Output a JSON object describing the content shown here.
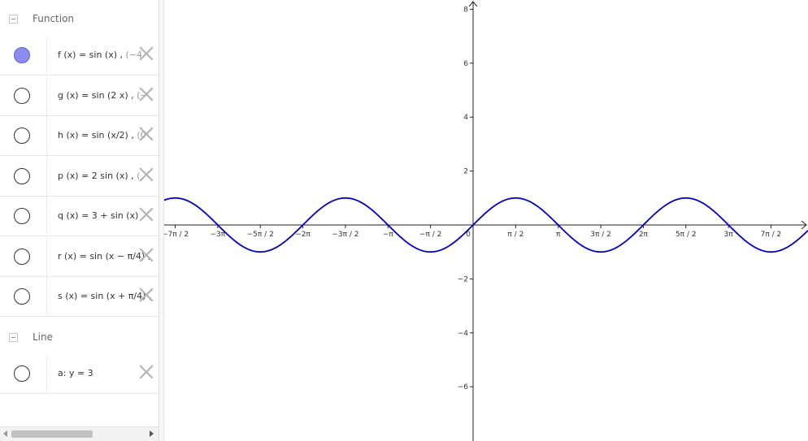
{
  "algebra": {
    "groups": [
      {
        "label": "Function",
        "items": [
          {
            "prefix": "f (x)  =  sin (x) ,",
            "suffix": "  (−4",
            "visible": true
          },
          {
            "prefix": "g (x)  =  sin (2 x) ,",
            "suffix": " (−",
            "visible": false
          },
          {
            "prefix": "h (x)  =  sin (x/2) ,",
            "suffix": " (0",
            "visible": false
          },
          {
            "prefix": "p (x)  =  2  sin (x) ,",
            "suffix": " (",
            "visible": false
          },
          {
            "prefix": "q (x)  =  3 + sin (x) ,",
            "suffix": "",
            "visible": false
          },
          {
            "prefix": "r (x)  =  sin (x − π/4) ,",
            "suffix": "",
            "visible": false
          },
          {
            "prefix": "s (x)  =  sin (x + π/4) ,",
            "suffix": "",
            "visible": false
          }
        ]
      },
      {
        "label": "Line",
        "items": [
          {
            "prefix": "a:  y  =  3",
            "suffix": "",
            "visible": false
          }
        ]
      }
    ]
  },
  "graph": {
    "curve_color": "#0000cc",
    "function": "sin(x)",
    "x_tick_labels": [
      "−7π / 2",
      "−3π",
      "−5π / 2",
      "−2π",
      "−3π / 2",
      "−π",
      "−π / 2",
      "0",
      "π / 2",
      "π",
      "3π / 2",
      "2π",
      "5π / 2",
      "3π",
      "7π / 2"
    ],
    "y_tick_labels": [
      "8",
      "6",
      "4",
      "2",
      "−2",
      "−4",
      "−6"
    ]
  }
}
